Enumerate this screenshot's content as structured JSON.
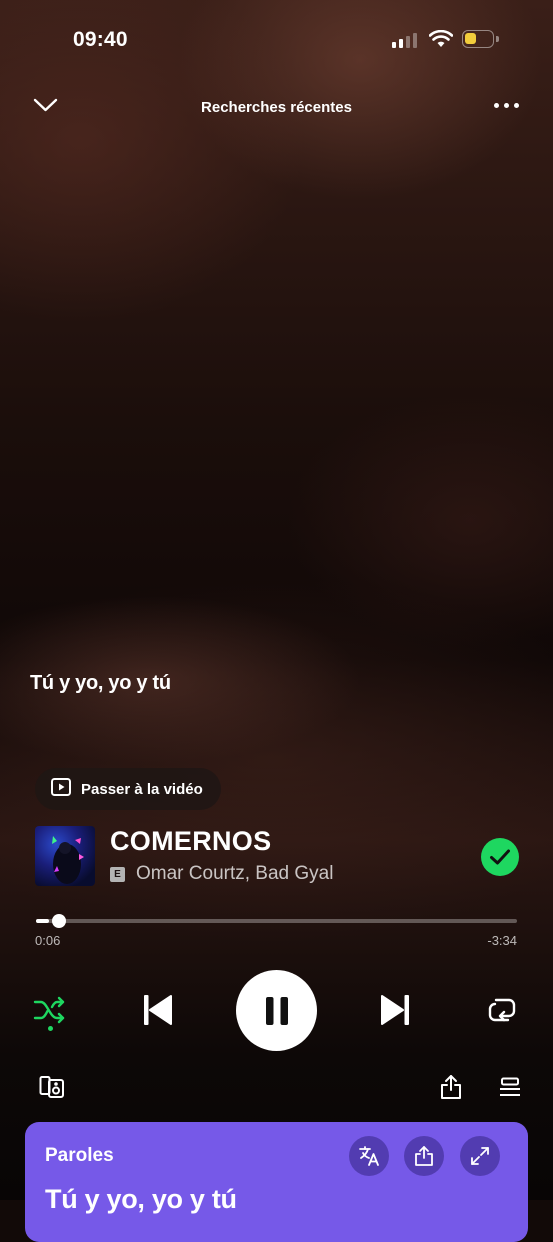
{
  "status_bar": {
    "time": "09:40",
    "battery_color": "#f2cd3c"
  },
  "header": {
    "title": "Recherches récentes",
    "collapse_icon": "chevron-down-icon",
    "menu_icon": "more-horizontal-icon"
  },
  "current_lyric": "Tú y yo, yo y tú",
  "video_button": {
    "label": "Passer à la vidéo",
    "icon": "video-play-icon"
  },
  "track": {
    "title": "COMERNOS",
    "explicit_badge": "E",
    "artists": "Omar Courtz, Bad Gyal",
    "saved": true
  },
  "progress": {
    "elapsed": "0:06",
    "remaining": "-3:34",
    "fraction": 0.028
  },
  "controls": {
    "shuffle_on": true,
    "playing": true,
    "accent_color": "#1ed760"
  },
  "lyrics_card": {
    "label": "Paroles",
    "preview": "Tú y yo, yo y tú",
    "background": "#7659e8"
  }
}
